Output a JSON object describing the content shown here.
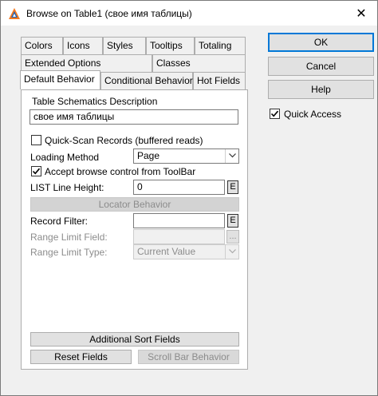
{
  "window": {
    "title": "Browse on Table1 (свое имя таблицы)",
    "close_icon": "close-icon",
    "app_icon": "clarion-app-icon"
  },
  "tabs": {
    "row0": [
      "Colors",
      "Icons",
      "Styles",
      "Tooltips",
      "Totaling"
    ],
    "row1": [
      "Extended Options",
      "Classes"
    ],
    "row2": [
      "Default Behavior",
      "Conditional Behavior",
      "Hot Fields"
    ],
    "active": "Default Behavior"
  },
  "side_buttons": {
    "ok": "OK",
    "cancel": "Cancel",
    "help": "Help",
    "quick_access_label": "Quick Access",
    "quick_access_checked": true
  },
  "panel": {
    "description_group_label": "Table Schematics Description",
    "description_value": "свое имя таблицы",
    "quick_scan_label": "Quick-Scan Records (buffered reads)",
    "quick_scan_checked": false,
    "loading_method_label": "Loading Method",
    "loading_method_value": "Page",
    "accept_browse_label": "Accept browse control from ToolBar",
    "accept_browse_checked": true,
    "list_line_height_label": "LIST Line Height:",
    "list_line_height_value": "0",
    "e_button": "E",
    "locator_behavior": "Locator Behavior",
    "record_filter_label": "Record Filter:",
    "record_filter_value": "",
    "range_limit_field_label": "Range Limit Field:",
    "range_limit_field_value": "",
    "ellipsis_button": "...",
    "range_limit_type_label": "Range Limit Type:",
    "range_limit_type_value": "Current Value",
    "additional_sort_fields": "Additional Sort Fields",
    "reset_fields": "Reset Fields",
    "scroll_bar_behavior": "Scroll Bar Behavior"
  }
}
